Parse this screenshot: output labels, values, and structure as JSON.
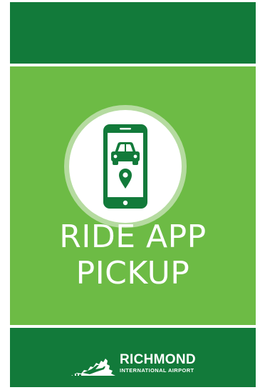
{
  "sign": {
    "title_line1": "RIDE APP",
    "title_line2": "PICKUP",
    "icon": "phone-car-location-icon"
  },
  "logo": {
    "name": "RICHMOND",
    "subtitle": "INTERNATIONAL AIRPORT",
    "mark": "virginia-state-airplane-logo"
  },
  "colors": {
    "dark_green": "#127a3a",
    "light_green": "#6dbb45",
    "ring_green": "#b5dba0",
    "white": "#ffffff"
  }
}
